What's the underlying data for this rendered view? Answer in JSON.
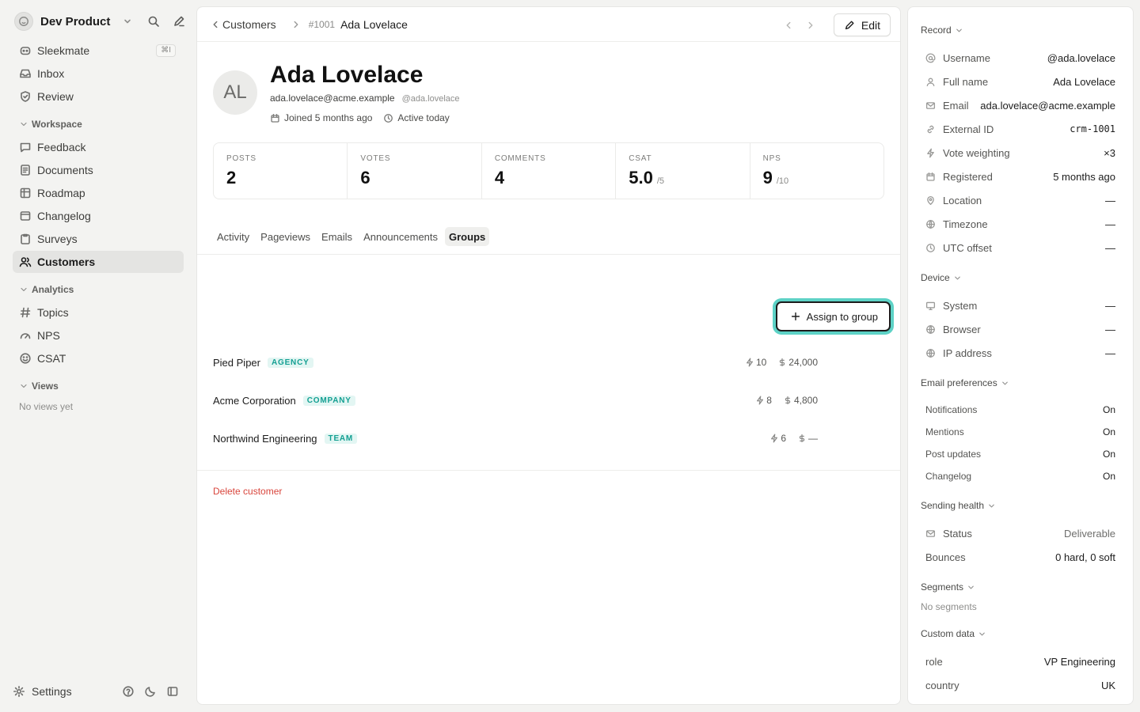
{
  "workspace": {
    "name": "Dev Product"
  },
  "sidebar": {
    "top_items": [
      {
        "label": "Sleekmate",
        "shortcut": "⌘I"
      },
      {
        "label": "Inbox"
      },
      {
        "label": "Review"
      }
    ],
    "workspace_section": "Workspace",
    "workspace_items": [
      {
        "label": "Feedback"
      },
      {
        "label": "Documents"
      },
      {
        "label": "Roadmap"
      },
      {
        "label": "Changelog"
      },
      {
        "label": "Surveys"
      },
      {
        "label": "Customers"
      }
    ],
    "analytics_section": "Analytics",
    "analytics_items": [
      {
        "label": "Topics"
      },
      {
        "label": "NPS"
      },
      {
        "label": "CSAT"
      }
    ],
    "views_section": "Views",
    "views_empty": "No views yet",
    "settings_label": "Settings"
  },
  "header": {
    "back_label": "Customers",
    "record_number": "#1001",
    "record_name": "Ada Lovelace",
    "edit_label": "Edit"
  },
  "profile": {
    "initials": "AL",
    "name": "Ada Lovelace",
    "email": "ada.lovelace@acme.example",
    "handle": "@ada.lovelace",
    "joined": "Joined 5 months ago",
    "active": "Active today"
  },
  "stats": [
    {
      "label": "POSTS",
      "value": "2",
      "suffix": ""
    },
    {
      "label": "VOTES",
      "value": "6",
      "suffix": ""
    },
    {
      "label": "COMMENTS",
      "value": "4",
      "suffix": ""
    },
    {
      "label": "CSAT",
      "value": "5.0",
      "suffix": "/5"
    },
    {
      "label": "NPS",
      "value": "9",
      "suffix": "/10"
    }
  ],
  "tabs": [
    "Activity",
    "Pageviews",
    "Emails",
    "Announcements",
    "Groups"
  ],
  "active_tab": "Groups",
  "assign_label": "Assign to group",
  "groups": [
    {
      "name": "Pied Piper",
      "type": "AGENCY",
      "votes": "10",
      "revenue": "24,000"
    },
    {
      "name": "Acme Corporation",
      "type": "COMPANY",
      "votes": "8",
      "revenue": "4,800"
    },
    {
      "name": "Northwind Engineering",
      "type": "TEAM",
      "votes": "6",
      "revenue": "—"
    }
  ],
  "delete_label": "Delete customer",
  "details": {
    "record_title": "Record",
    "record": [
      {
        "label": "Username",
        "value": "@ada.lovelace",
        "icon": "at-icon"
      },
      {
        "label": "Full name",
        "value": "Ada Lovelace",
        "icon": "user-icon"
      },
      {
        "label": "Email",
        "value": "ada.lovelace@acme.example",
        "icon": "mail-icon"
      },
      {
        "label": "External ID",
        "value": "crm-1001",
        "icon": "link-icon"
      },
      {
        "label": "Vote weighting",
        "value": "×3",
        "icon": "bolt-icon"
      },
      {
        "label": "Registered",
        "value": "5 months ago",
        "icon": "calendar-icon"
      },
      {
        "label": "Location",
        "value": "—",
        "icon": "pin-icon"
      },
      {
        "label": "Timezone",
        "value": "—",
        "icon": "globe-icon"
      },
      {
        "label": "UTC offset",
        "value": "—",
        "icon": "clock-icon"
      }
    ],
    "device_title": "Device",
    "device": [
      {
        "label": "System",
        "value": "—",
        "icon": "monitor-icon"
      },
      {
        "label": "Browser",
        "value": "—",
        "icon": "globe-icon"
      },
      {
        "label": "IP address",
        "value": "—",
        "icon": "globe-icon"
      }
    ],
    "email_prefs_title": "Email preferences",
    "email_prefs": [
      {
        "label": "Notifications",
        "value": "On"
      },
      {
        "label": "Mentions",
        "value": "On"
      },
      {
        "label": "Post updates",
        "value": "On"
      },
      {
        "label": "Changelog",
        "value": "On"
      }
    ],
    "health_title": "Sending health",
    "health_status_label": "Status",
    "health_status_value": "Deliverable",
    "health_bounces_label": "Bounces",
    "health_bounces_value": "0 hard, 0 soft",
    "segments_title": "Segments",
    "segments_empty": "No segments",
    "custom_title": "Custom data",
    "custom": [
      {
        "label": "role",
        "value": "VP Engineering"
      },
      {
        "label": "country",
        "value": "UK"
      }
    ]
  },
  "colors": {
    "accent": "#5dd2c6",
    "badge_text": "#139f92",
    "badge_bg": "#e3f6f3",
    "danger": "#d9453c"
  }
}
